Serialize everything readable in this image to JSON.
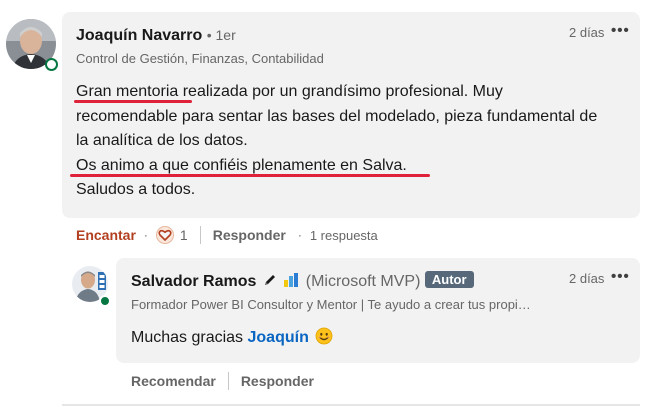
{
  "comment": {
    "author": "Joaquín Navarro",
    "degree": "• 1er",
    "headline": "Control de Gestión, Finanzas, Contabilidad",
    "time": "2 días",
    "more": "•••",
    "body_lines": [
      "Gran mentoria realizada por un grandísimo profesional. Muy",
      "recomendable para sentar las bases del modelado, pieza fundamental de",
      "la analítica de los datos.",
      "Os animo a que confiéis plenamente en Salva.",
      "Saludos a todos."
    ],
    "actions": {
      "react_label": "Encantar",
      "reaction_count": "1",
      "reply_label": "Responder",
      "replies_count": "1 respuesta"
    }
  },
  "reply": {
    "author": "Salvador Ramos",
    "author_suffix": "(Microsoft MVP)",
    "badge": "Autor",
    "headline": "Formador Power BI Consultor y Mentor | Te ayudo a crear tus propi…",
    "time": "2 días",
    "more": "•••",
    "message_prefix": "Muchas gracias",
    "mention": "Joaquín",
    "emoji": "😊",
    "actions": {
      "recommend_label": "Recomendar",
      "reply_label": "Responder"
    }
  },
  "colors": {
    "underline": "#e0213a",
    "online": "#057642",
    "react": "#b24020",
    "mention": "#0a66c2",
    "badge": "#56687a"
  }
}
